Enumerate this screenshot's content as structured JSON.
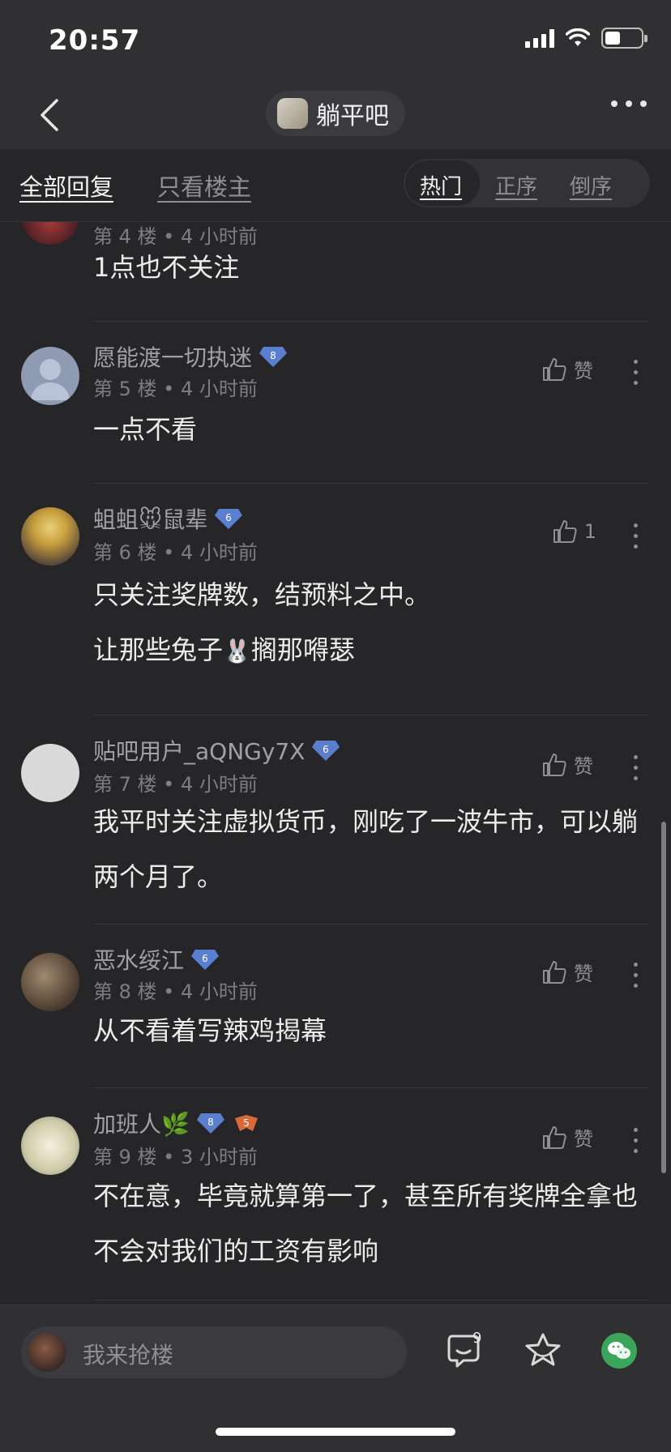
{
  "status_bar": {
    "time": "20:57"
  },
  "nav": {
    "forum_name": "躺平吧"
  },
  "tabs": {
    "all_replies": "全部回复",
    "owner_only": "只看楼主"
  },
  "sort": {
    "hot": "热门",
    "asc": "正序",
    "desc": "倒序"
  },
  "posts": [
    {
      "floor": "第 4 楼",
      "time": "4 小时前",
      "content": [
        "1点也不关注"
      ]
    },
    {
      "user": "愿能渡一切执迷",
      "level": "8",
      "floor": "第 5 楼",
      "time": "4 小时前",
      "like": "赞",
      "content": [
        "一点不看"
      ]
    },
    {
      "user_prefix": "蛆蛆",
      "user_emoji": "🐭",
      "user_suffix": "鼠辈",
      "level": "6",
      "floor": "第 6 楼",
      "time": "4 小时前",
      "like": "1",
      "content": [
        "只关注奖牌数，结预料之中。",
        "让那些兔子",
        "🐰",
        "搁那嘚瑟"
      ]
    },
    {
      "user": "贴吧用户_aQNGy7X",
      "level": "6",
      "floor": "第 7 楼",
      "time": "4 小时前",
      "like": "赞",
      "content": [
        "我平时关注虚拟货币，刚吃了一波牛市，可以躺两个月了。"
      ]
    },
    {
      "user": "恶水绥江",
      "level": "6",
      "floor": "第 8 楼",
      "time": "4 小时前",
      "like": "赞",
      "content": [
        "从不看着写辣鸡揭幕"
      ]
    },
    {
      "user": "加班人",
      "user_emoji": "🌿",
      "level": "8",
      "level2": "5",
      "floor": "第 9 楼",
      "time": "3 小时前",
      "like": "赞",
      "content": [
        "不在意，毕竟就算第一了，甚至所有奖牌全拿也不会对我们的工资有影响"
      ]
    }
  ],
  "bottom_bar": {
    "reply_placeholder": "我来抢楼",
    "comment_count": "9"
  },
  "colors": {
    "background": "#262629",
    "bar": "#303033",
    "badge": "#5b7fcf",
    "wechat": "#3ba55c"
  }
}
